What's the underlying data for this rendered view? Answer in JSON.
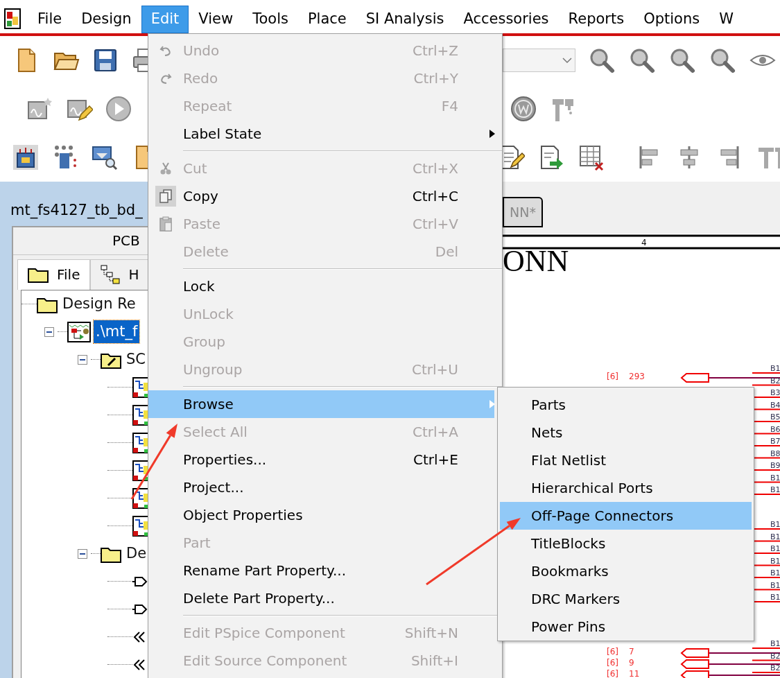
{
  "menu_bar": [
    {
      "label": "File",
      "selected": false
    },
    {
      "label": "Design",
      "selected": false
    },
    {
      "label": "Edit",
      "selected": true
    },
    {
      "label": "View",
      "selected": false
    },
    {
      "label": "Tools",
      "selected": false
    },
    {
      "label": "Place",
      "selected": false
    },
    {
      "label": "SI Analysis",
      "selected": false
    },
    {
      "label": "Accessories",
      "selected": false
    },
    {
      "label": "Reports",
      "selected": false
    },
    {
      "label": "Options",
      "selected": false
    },
    {
      "label": "W",
      "selected": false
    }
  ],
  "project_panel": {
    "title": "mt_fs4127_tb_bd_",
    "header": "PCB",
    "tabs": [
      {
        "label": "File",
        "selected": true
      },
      {
        "label": "H",
        "selected": false
      }
    ],
    "tree": [
      {
        "label": "Design Re",
        "kind": "folder",
        "selected": false,
        "children": [
          {
            "label": ".\\mt_f",
            "kind": "design",
            "expanded": true,
            "selected": true,
            "children": [
              {
                "label": "SC",
                "kind": "schematics",
                "expanded": true,
                "selected": false,
                "children": [
                  {
                    "kind": "page",
                    "selected": false
                  },
                  {
                    "kind": "page",
                    "selected": false
                  },
                  {
                    "kind": "page",
                    "selected": false
                  },
                  {
                    "kind": "page",
                    "selected": false
                  },
                  {
                    "kind": "page",
                    "selected": false
                  },
                  {
                    "kind": "page",
                    "selected": false
                  }
                ]
              },
              {
                "label": "De",
                "kind": "folder",
                "expanded": true,
                "selected": false,
                "children": [
                  {
                    "kind": "port",
                    "selected": false
                  },
                  {
                    "kind": "port",
                    "selected": false
                  },
                  {
                    "kind": "offpage",
                    "selected": false
                  },
                  {
                    "kind": "offpage",
                    "selected": false
                  }
                ]
              }
            ]
          }
        ]
      }
    ]
  },
  "edit_menu": [
    {
      "kind": "command",
      "label": "Undo",
      "shortcut": "Ctrl+Z",
      "disabled": true,
      "selected": false
    },
    {
      "kind": "command",
      "label": "Redo",
      "shortcut": "Ctrl+Y",
      "disabled": true,
      "selected": false
    },
    {
      "kind": "command",
      "label": "Repeat",
      "shortcut": "F4",
      "disabled": true,
      "selected": false
    },
    {
      "kind": "submenu",
      "label": "Label State",
      "disabled": false,
      "selected": false
    },
    {
      "kind": "separator"
    },
    {
      "kind": "command",
      "label": "Cut",
      "shortcut": "Ctrl+X",
      "disabled": true,
      "selected": false
    },
    {
      "kind": "command",
      "label": "Copy",
      "shortcut": "Ctrl+C",
      "disabled": false,
      "selected": false
    },
    {
      "kind": "command",
      "label": "Paste",
      "shortcut": "Ctrl+V",
      "disabled": true,
      "selected": false
    },
    {
      "kind": "command",
      "label": "Delete",
      "shortcut": "Del",
      "disabled": true,
      "selected": false
    },
    {
      "kind": "separator"
    },
    {
      "kind": "command",
      "label": "Lock",
      "disabled": false,
      "selected": false
    },
    {
      "kind": "command",
      "label": "UnLock",
      "disabled": true,
      "selected": false
    },
    {
      "kind": "command",
      "label": "Group",
      "disabled": true,
      "selected": false
    },
    {
      "kind": "command",
      "label": "Ungroup",
      "shortcut": "Ctrl+U",
      "disabled": true,
      "selected": false
    },
    {
      "kind": "separator"
    },
    {
      "kind": "submenu",
      "label": "Browse",
      "disabled": false,
      "selected": true
    },
    {
      "kind": "command",
      "label": "Select All",
      "shortcut": "Ctrl+A",
      "disabled": true,
      "selected": false
    },
    {
      "kind": "command",
      "label": "Properties...",
      "shortcut": "Ctrl+E",
      "disabled": false,
      "selected": false
    },
    {
      "kind": "command",
      "label": "Project...",
      "disabled": false,
      "selected": false
    },
    {
      "kind": "command",
      "label": "Object Properties",
      "disabled": false,
      "selected": false
    },
    {
      "kind": "command",
      "label": "Part",
      "disabled": true,
      "selected": false
    },
    {
      "kind": "command",
      "label": "Rename Part Property...",
      "disabled": false,
      "selected": false
    },
    {
      "kind": "command",
      "label": "Delete Part Property...",
      "disabled": false,
      "selected": false
    },
    {
      "kind": "separator"
    },
    {
      "kind": "command",
      "label": "Edit PSpice Component",
      "shortcut": "Shift+N",
      "disabled": true,
      "selected": false
    },
    {
      "kind": "command",
      "label": "Edit Source Component",
      "shortcut": "Shift+I",
      "disabled": true,
      "selected": false
    }
  ],
  "browse_submenu": [
    {
      "label": "Parts",
      "selected": false
    },
    {
      "label": "Nets",
      "selected": false
    },
    {
      "label": "Flat Netlist",
      "selected": false
    },
    {
      "label": "Hierarchical Ports",
      "selected": false
    },
    {
      "label": "Off-Page Connectors",
      "selected": true
    },
    {
      "label": "TitleBlocks",
      "selected": false
    },
    {
      "label": "Bookmarks",
      "selected": false
    },
    {
      "label": "DRC Markers",
      "selected": false
    },
    {
      "label": "Power Pins",
      "selected": false
    }
  ],
  "schematic": {
    "tabs": [
      {
        "label": "NN*",
        "selected": false
      }
    ],
    "ruler": "4",
    "title": "ONN",
    "top_connectors": [
      {
        "sheet": "[6]",
        "net": "293"
      }
    ],
    "bottom_connectors": [
      {
        "sheet": "[6]",
        "net": "7"
      },
      {
        "sheet": "[6]",
        "net": "9"
      },
      {
        "sheet": "[6]",
        "net": "11"
      }
    ],
    "pin_groups": [
      [
        "B1",
        "B2",
        "B3",
        "B4",
        "B5",
        "B6",
        "B7",
        "B8",
        "B9",
        "B1",
        "B1"
      ],
      [
        "B1",
        "B1",
        "B1",
        "B1",
        "B1",
        "B1",
        "B1"
      ],
      [
        "B1",
        "B2",
        "B2"
      ]
    ]
  }
}
